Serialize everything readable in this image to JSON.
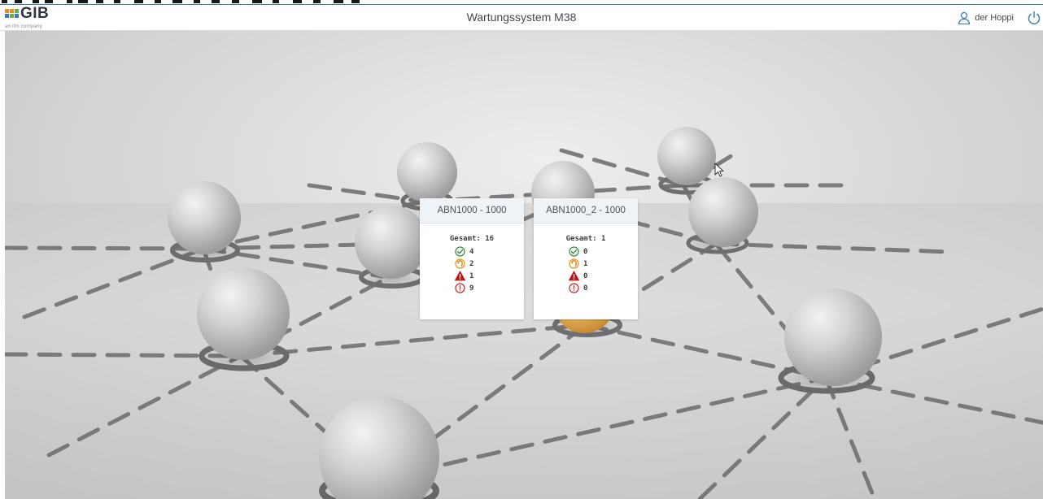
{
  "app": {
    "logo_text": "GIB",
    "logo_tagline": "an ifm company",
    "title": "Wartungssystem M38",
    "user_name": "der Hoppi"
  },
  "icons": {
    "user": "user-icon",
    "power": "power-icon",
    "ok": "check-circle-icon",
    "maintenance": "wrench-circle-icon",
    "warning": "warning-triangle-icon",
    "error": "exclamation-circle-icon"
  },
  "colors": {
    "ok": "#2e8b3a",
    "maintenance": "#e8911c",
    "warning": "#bb1616",
    "error": "#d32020",
    "header_accent": "#3d7ab8"
  },
  "cards": [
    {
      "title": "ABN1000 - 1000",
      "total_label": "Gesamt:",
      "total": "16",
      "ok": "4",
      "maintenance": "2",
      "warning": "1",
      "error": "9"
    },
    {
      "title": "ABN1000_2 - 1000",
      "total_label": "Gesamt:",
      "total": "1",
      "ok": "0",
      "maintenance": "1",
      "warning": "0",
      "error": "0"
    }
  ]
}
